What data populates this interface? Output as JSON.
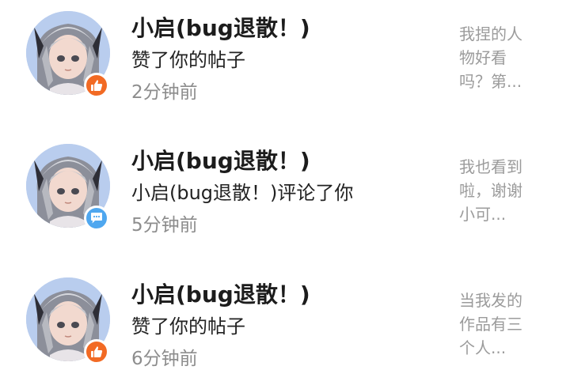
{
  "notifications": [
    {
      "user_name": "小启(bug退散！)",
      "action": "赞了你的帖子",
      "time": "2分钟前",
      "badge_type": "like-icon",
      "preview_lines": [
        "我捏的人",
        "物好看",
        "吗？第..."
      ]
    },
    {
      "user_name": "小启(bug退散！)",
      "action": "小启(bug退散！)评论了你",
      "time": "5分钟前",
      "badge_type": "comment-icon",
      "preview_lines": [
        "我也看到",
        "啦，谢谢",
        "小可..."
      ]
    },
    {
      "user_name": "小启(bug退散！)",
      "action": "赞了你的帖子",
      "time": "6分钟前",
      "badge_type": "like-icon",
      "preview_lines": [
        "当我发的",
        "作品有三",
        "个人..."
      ]
    }
  ],
  "colors": {
    "like_badge": "#f26a24",
    "comment_badge": "#4fa7ef",
    "name_text": "#1c1c1c",
    "time_text": "#8d8d8d",
    "preview_text": "#9b9b9b"
  }
}
